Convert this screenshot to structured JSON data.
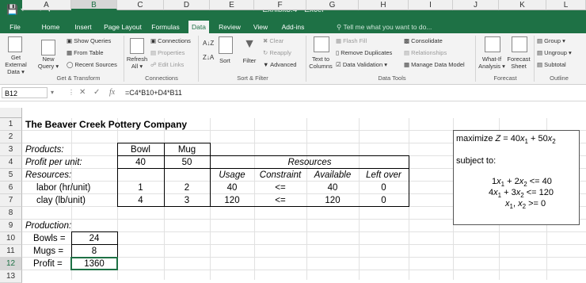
{
  "window": {
    "title": "Exhibit3.4 - Excel"
  },
  "tabs": [
    "File",
    "Home",
    "Insert",
    "Page Layout",
    "Formulas",
    "Data",
    "Review",
    "View",
    "Add-ins"
  ],
  "tell_me": "Tell me what you want to do...",
  "ribbon": {
    "get_external": "Get External",
    "get_external2": "Data",
    "show_queries": "Show Queries",
    "from_table": "From Table",
    "new_query": "New",
    "new_query2": "Query",
    "recent_sources": "Recent Sources",
    "refresh_all": "Refresh",
    "refresh_all2": "All",
    "connections": "Connections",
    "properties": "Properties",
    "edit_links": "Edit Links",
    "sort": "Sort",
    "filter": "Filter",
    "clear": "Clear",
    "reapply": "Reapply",
    "advanced": "Advanced",
    "text_to_columns": "Text to",
    "text_to_columns2": "Columns",
    "flash_fill": "Flash Fill",
    "remove_duplicates": "Remove Duplicates",
    "data_validation": "Data Validation",
    "consolidate": "Consolidate",
    "relationships": "Relationships",
    "manage_data_model": "Manage Data Model",
    "what_if": "What-If",
    "what_if2": "Analysis",
    "forecast_sheet": "Forecast",
    "forecast_sheet2": "Sheet",
    "group": "Group",
    "ungroup": "Ungroup",
    "subtotal": "Subtotal",
    "groups": [
      "Get & Transform",
      "Connections",
      "Sort & Filter",
      "Data Tools",
      "Forecast",
      "Outline"
    ]
  },
  "formula_bar": {
    "name_box": "B12",
    "formula": "=C4*B10+D4*B11"
  },
  "columns": [
    "A",
    "B",
    "C",
    "D",
    "E",
    "F",
    "G",
    "H",
    "I",
    "J",
    "K",
    "L"
  ],
  "rows": [
    "1",
    "2",
    "3",
    "4",
    "5",
    "6",
    "7",
    "8",
    "9",
    "10",
    "11",
    "12",
    "13"
  ],
  "sheet": {
    "title": "The Beaver Creek Pottery Company",
    "products_label": "Products:",
    "bowl": "Bowl",
    "mug": "Mug",
    "profit_label": "Profit per unit:",
    "profit_bowl": "40",
    "profit_mug": "50",
    "resources_header": "Resources",
    "resources_label": "Resources:",
    "usage": "Usage",
    "constraint": "Constraint",
    "available": "Available",
    "left_over": "Left over",
    "labor_label": "labor (hr/unit)",
    "labor_bowl": "1",
    "labor_mug": "2",
    "labor_usage": "40",
    "labor_constraint": "<=",
    "labor_available": "40",
    "labor_left": "0",
    "clay_label": "clay (lb/unit)",
    "clay_bowl": "4",
    "clay_mug": "3",
    "clay_usage": "120",
    "clay_constraint": "<=",
    "clay_available": "120",
    "clay_left": "0",
    "production_label": "Production:",
    "bowls_label": "Bowls =",
    "bowls_value": "24",
    "mugs_label": "Mugs =",
    "mugs_value": "8",
    "profit_total_label": "Profit =",
    "profit_total_value": "1360"
  },
  "model_box": {
    "maximize": "maximize",
    "subject_to": "subject to:"
  }
}
